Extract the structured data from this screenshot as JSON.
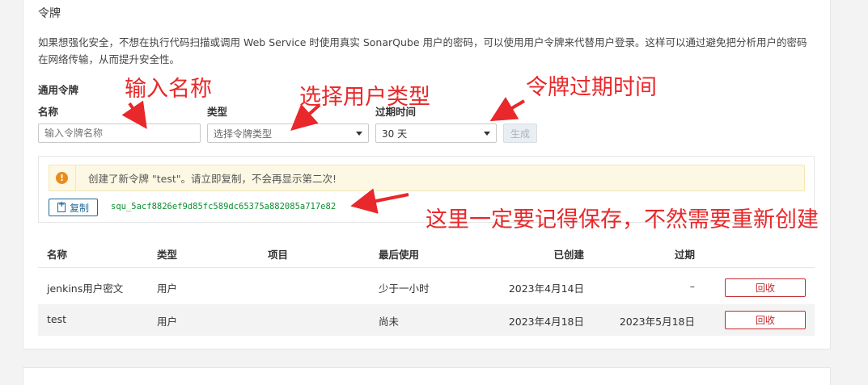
{
  "section_title": "令牌",
  "description": "如果想强化安全，不想在执行代码扫描或调用 Web Service 时使用真实 SonarQube 用户的密码，可以使用用户令牌来代替用户登录。这样可以通过避免把分析用户的密码在网络传输，从而提升安全性。",
  "generate": {
    "heading": "通用令牌",
    "name_label": "名称",
    "name_placeholder": "输入令牌名称",
    "type_label": "类型",
    "type_value": "选择令牌类型",
    "expiry_label": "过期时间",
    "expiry_value": "30 天",
    "generate_button": "生成"
  },
  "new_token": {
    "alert_text": "创建了新令牌 \"test\"。请立即复制，不会再显示第二次!",
    "copy_button": "复制",
    "token_value": "squ_5acf8826ef9d85fc589dc65375a882085a717e82"
  },
  "table": {
    "headers": [
      "名称",
      "类型",
      "项目",
      "最后使用",
      "已创建",
      "过期"
    ],
    "rows": [
      {
        "name": "jenkins用户密文",
        "type": "用户",
        "project": "",
        "last_used": "少于一小时",
        "created": "2023年4月14日",
        "expires": "–",
        "action": "回收"
      },
      {
        "name": "test",
        "type": "用户",
        "project": "",
        "last_used": "尚未",
        "created": "2023年4月18日",
        "expires": "2023年5月18日",
        "action": "回收"
      }
    ]
  },
  "annotations": {
    "name": "输入名称",
    "type": "选择用户类型",
    "expiry": "令牌过期时间",
    "save": "这里一定要记得保存，不然需要重新创建"
  },
  "colors": {
    "annotation": "#e8282a",
    "token_text": "#0b8f2f",
    "primary": "#236a97",
    "danger": "#c22b2e",
    "warning_icon": "#e98c1c"
  }
}
